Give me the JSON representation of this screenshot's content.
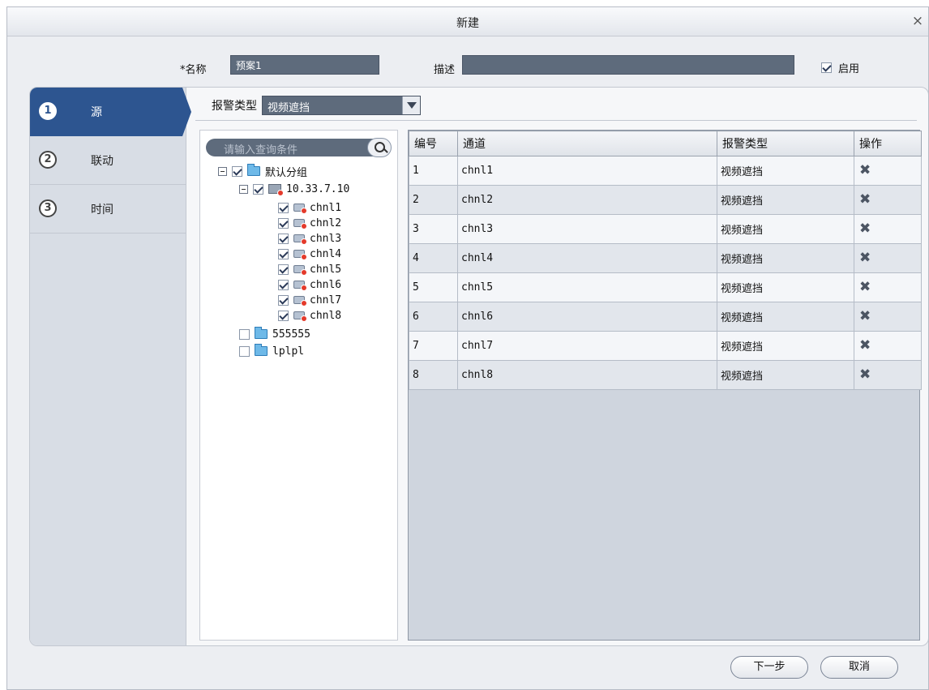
{
  "window": {
    "title": "新建",
    "close_glyph": "×"
  },
  "form": {
    "name_label": "*名称",
    "name_value": "预案1",
    "desc_label": "描述",
    "desc_value": "",
    "enable_label": "启用",
    "enable_checked": true
  },
  "steps": [
    {
      "num": "1",
      "label": "源",
      "active": true
    },
    {
      "num": "2",
      "label": "联动",
      "active": false
    },
    {
      "num": "3",
      "label": "时间",
      "active": false
    }
  ],
  "alarm_type": {
    "label": "报警类型",
    "value": "视频遮挡"
  },
  "tree": {
    "search_placeholder": "请输入查询条件",
    "root": "默认分组",
    "device": "10.33.7.10",
    "channels": [
      "chnl1",
      "chnl2",
      "chnl3",
      "chnl4",
      "chnl5",
      "chnl6",
      "chnl7",
      "chnl8"
    ],
    "groups": [
      "555555",
      "lplpl"
    ]
  },
  "table": {
    "headers": [
      "编号",
      "通道",
      "报警类型",
      "操作"
    ],
    "rows": [
      {
        "id": "1",
        "channel": "chnl1",
        "type": "视频遮挡",
        "action_icon": "delete-icon"
      },
      {
        "id": "2",
        "channel": "chnl2",
        "type": "视频遮挡",
        "action_icon": "delete-icon"
      },
      {
        "id": "3",
        "channel": "chnl3",
        "type": "视频遮挡",
        "action_icon": "delete-icon"
      },
      {
        "id": "4",
        "channel": "chnl4",
        "type": "视频遮挡",
        "action_icon": "delete-icon"
      },
      {
        "id": "5",
        "channel": "chnl5",
        "type": "视频遮挡",
        "action_icon": "delete-icon"
      },
      {
        "id": "6",
        "channel": "chnl6",
        "type": "视频遮挡",
        "action_icon": "delete-icon"
      },
      {
        "id": "7",
        "channel": "chnl7",
        "type": "视频遮挡",
        "action_icon": "delete-icon"
      },
      {
        "id": "8",
        "channel": "chnl8",
        "type": "视频遮挡",
        "action_icon": "delete-icon"
      }
    ]
  },
  "buttons": {
    "next": "下一步",
    "cancel": "取消"
  },
  "colors": {
    "accent": "#2d5590",
    "field_bg": "#5e6b7c"
  }
}
